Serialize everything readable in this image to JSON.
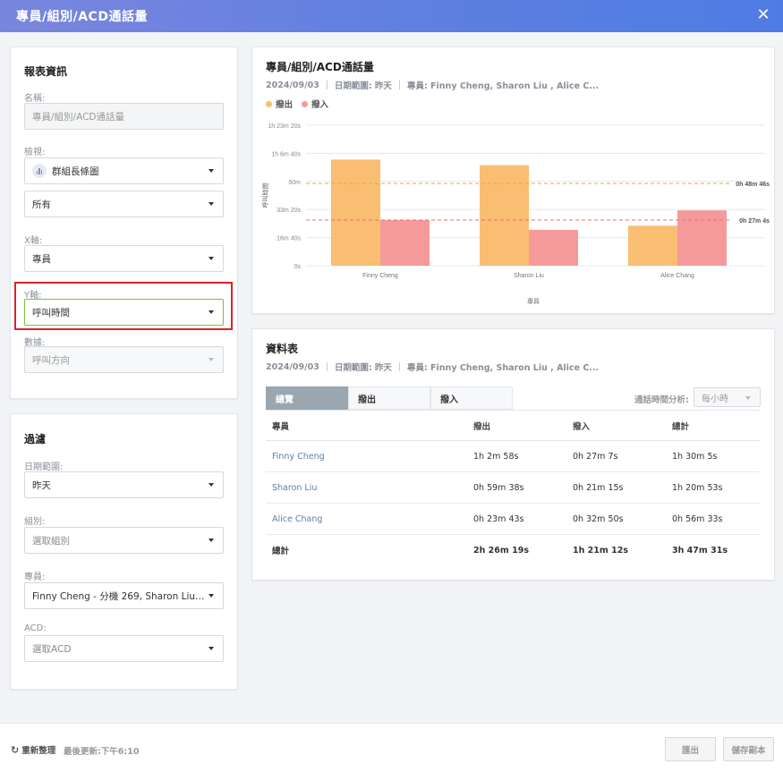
{
  "window": {
    "title": "專員/組別/ACD通話量"
  },
  "report_info": {
    "title": "報表資訊",
    "name_label": "名稱:",
    "name_value": "專員/組別/ACD通話量",
    "view_label": "檢視:",
    "view_value": "群組長條圖",
    "view2_value": "所有",
    "x_label": "X軸:",
    "x_value": "專員",
    "y_label": "Y軸:",
    "y_value": "呼叫時間",
    "data_label": "數據:",
    "data_value": "呼叫方向"
  },
  "filter": {
    "title": "過濾",
    "date_label": "日期範圍:",
    "date_value": "昨天",
    "group_label": "組別:",
    "group_placeholder": "選取組別",
    "agent_label": "專員:",
    "agent_value": "Finny Cheng - 分機 269, Sharon Liu  - 分...",
    "acd_label": "ACD:",
    "acd_placeholder": "選取ACD"
  },
  "chart_panel": {
    "title": "專員/組別/ACD通話量",
    "date": "2024/09/03",
    "range": "日期範圍: 昨天",
    "agents": "專員: Finny Cheng, Sharon Liu , Alice C...",
    "legend": [
      {
        "label": "撥出",
        "color": "#f9be72"
      },
      {
        "label": "撥入",
        "color": "#f59a9b"
      }
    ]
  },
  "chart_data": {
    "type": "bar",
    "categories": [
      "Finny Cheng",
      "Sharon Liu",
      "Alice Chang"
    ],
    "series": [
      {
        "name": "撥出",
        "color": "#f9be72",
        "values": [
          62.97,
          59.63,
          23.72
        ]
      },
      {
        "name": "撥入",
        "color": "#f59a9b",
        "values": [
          27.12,
          21.25,
          32.83
        ]
      }
    ],
    "y_ticks": [
      {
        "value": 0,
        "label": "0s"
      },
      {
        "value": 16.67,
        "label": "16m 40s"
      },
      {
        "value": 33.33,
        "label": "33m 20s"
      },
      {
        "value": 50,
        "label": "50m"
      },
      {
        "value": 66.67,
        "label": "1h 6m 40s"
      },
      {
        "value": 83.33,
        "label": "1h 23m 20s"
      }
    ],
    "ylim": [
      0,
      83.33
    ],
    "ylabel": "呼叫時間",
    "xlabel": "專員",
    "reference_lines": [
      {
        "value": 48.77,
        "label": "0h 48m 46s",
        "color": "#f2a93b"
      },
      {
        "value": 27.07,
        "label": "0h 27m 4s",
        "color": "#ec6b6d"
      }
    ],
    "grid": true,
    "legend": "top-left"
  },
  "table_panel": {
    "title": "資料表",
    "date": "2024/09/03",
    "range": "日期範圍: 昨天",
    "agents": "專員: Finny Cheng, Sharon Liu , Alice C...",
    "tabs": [
      "總覽",
      "撥出",
      "撥入"
    ],
    "analysis_label": "通話時間分析:",
    "analysis_value": "每小時",
    "columns": [
      "專員",
      "撥出",
      "撥入",
      "總計"
    ],
    "rows": [
      [
        "Finny Cheng",
        "1h 2m 58s",
        "0h 27m 7s",
        "1h 30m 5s"
      ],
      [
        "Sharon Liu",
        "0h 59m 38s",
        "0h 21m 15s",
        "1h 20m 53s"
      ],
      [
        "Alice Chang",
        "0h 23m 43s",
        "0h 32m 50s",
        "0h 56m 33s"
      ]
    ],
    "total": [
      "總計",
      "2h 26m 19s",
      "1h 21m 12s",
      "3h 47m 31s"
    ]
  },
  "footer": {
    "refresh_label": "重新整理",
    "updated": "最後更新:下午6:10",
    "export_label": "匯出",
    "save_copy_label": "儲存副本"
  }
}
